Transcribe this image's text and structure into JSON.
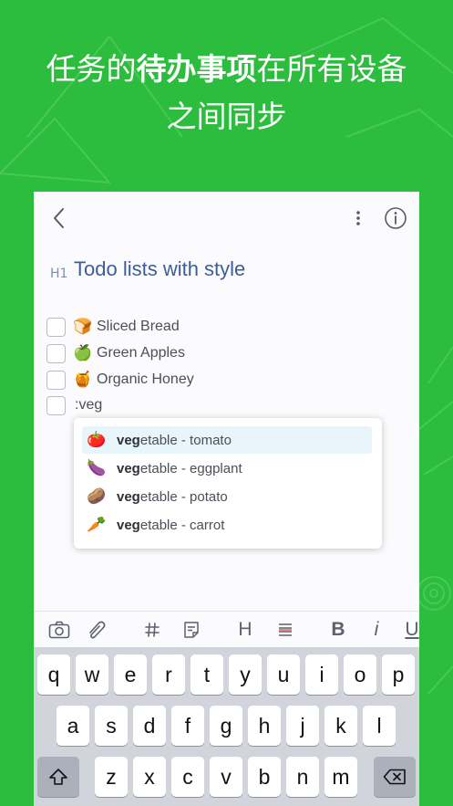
{
  "headline": {
    "line1_pre": "任务的",
    "line1_bold": "待办事项",
    "line1_post": "在所有设备",
    "line2": "之间同步"
  },
  "colors": {
    "background": "#2dbd3e",
    "title": "#3d5d9a",
    "highlight": "#e8f6fb"
  },
  "note": {
    "heading_tag": "H1",
    "title": "Todo lists with style",
    "todos": [
      {
        "emoji": "🍞",
        "text": "Sliced Bread"
      },
      {
        "emoji": "🍏",
        "text": "Green Apples"
      },
      {
        "emoji": "🍯",
        "text": "Organic Honey"
      }
    ],
    "typing": ":veg"
  },
  "suggestions": [
    {
      "emoji": "🍅",
      "bold": "veg",
      "rest": "etable - tomato",
      "highlighted": true
    },
    {
      "emoji": "🍆",
      "bold": "veg",
      "rest": "etable - eggplant",
      "highlighted": false
    },
    {
      "emoji": "🥔",
      "bold": "veg",
      "rest": "etable - potato",
      "highlighted": false
    },
    {
      "emoji": "🥕",
      "bold": "veg",
      "rest": "etable - carrot",
      "highlighted": false
    }
  ],
  "toolbar": {
    "icons": [
      "camera-icon",
      "attachment-icon",
      "hashtag-icon",
      "note-link-icon",
      "heading-icon",
      "list-icon",
      "bold-icon",
      "italic-icon",
      "underline-icon"
    ],
    "heading_label": "H",
    "bold_label": "B",
    "italic_label": "i",
    "underline_label": "U"
  },
  "keyboard": {
    "row1": [
      "q",
      "w",
      "e",
      "r",
      "t",
      "y",
      "u",
      "i",
      "o",
      "p"
    ],
    "row2": [
      "a",
      "s",
      "d",
      "f",
      "g",
      "h",
      "j",
      "k",
      "l"
    ],
    "row3": [
      "z",
      "x",
      "c",
      "v",
      "b",
      "n",
      "m"
    ],
    "shift_icon": "shift-icon",
    "delete_icon": "backspace-icon"
  }
}
